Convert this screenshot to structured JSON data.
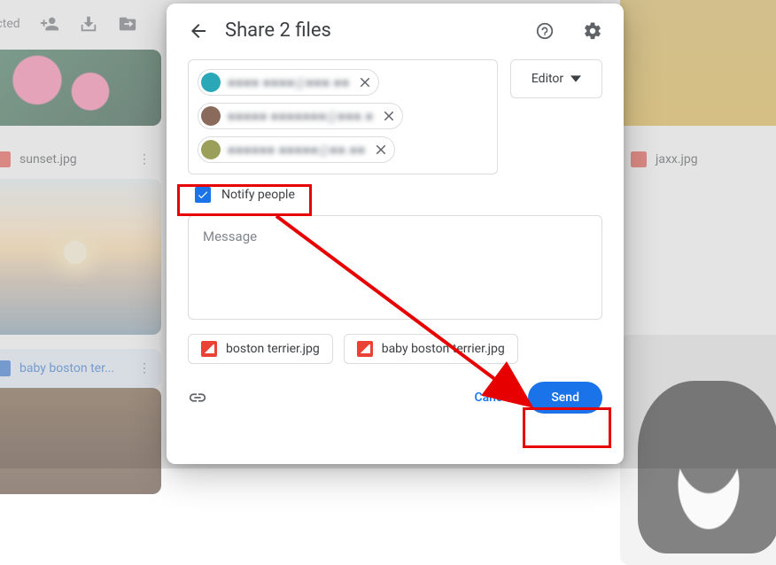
{
  "background": {
    "toolbar_text": "selected",
    "thumbs": {
      "sunset": "sunset.jpg",
      "jaxx": "jaxx.jpg",
      "boston": "baby boston ter..."
    }
  },
  "modal": {
    "title": "Share 2 files",
    "recipients": [
      {
        "avatar": "#2aa8b8",
        "blur_text": "■■■■ ■■■■@■■■.■■"
      },
      {
        "avatar": "#8a6a5a",
        "blur_text": "■■■■■ ■■■■■■■@■■■.■"
      },
      {
        "avatar": "#9aa05a",
        "blur_text": "■■■■■■ ■■■■■@■■.■■"
      }
    ],
    "role_label": "Editor",
    "notify_label": "Notify people",
    "message_placeholder": "Message",
    "shared_files": [
      "boston terrier.jpg",
      "baby boston terrier.jpg"
    ],
    "cancel_label": "Cancel",
    "send_label": "Send"
  }
}
